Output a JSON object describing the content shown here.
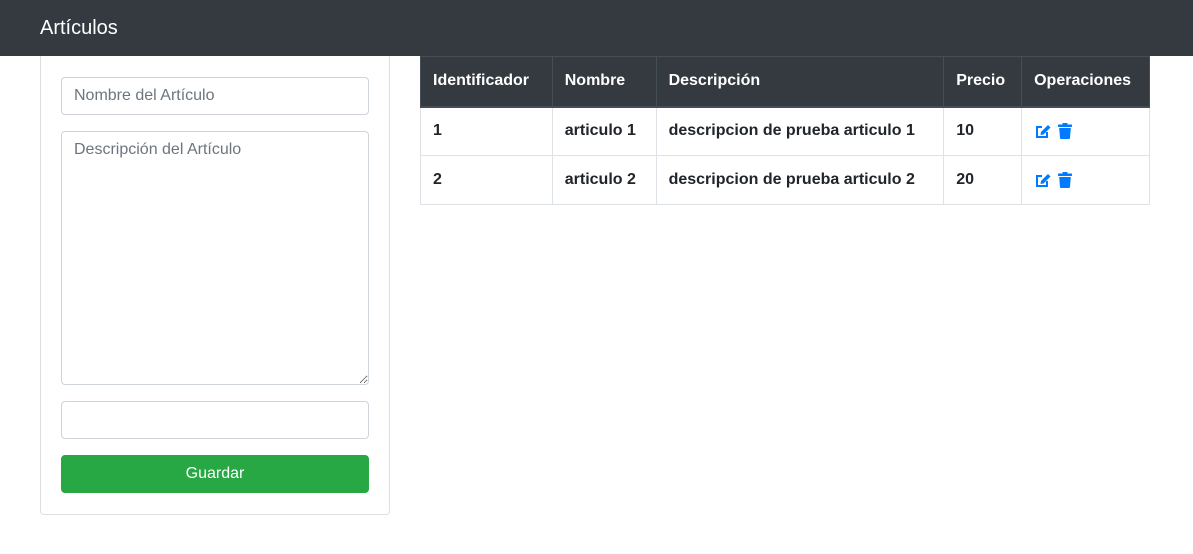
{
  "navbar": {
    "brand": "Artículos"
  },
  "form": {
    "name_placeholder": "Nombre del Artículo",
    "name_value": "",
    "description_placeholder": "Descripción del Artículo",
    "description_value": "",
    "price_placeholder": "",
    "price_value": "",
    "save_label": "Guardar"
  },
  "table": {
    "headers": {
      "id": "Identificador",
      "name": "Nombre",
      "description": "Descripción",
      "price": "Precio",
      "operations": "Operaciones"
    },
    "rows": [
      {
        "id": "1",
        "name": "articulo 1",
        "description": "descripcion de prueba articulo 1",
        "price": "10",
        "icons": [
          "edit-icon",
          "trash-icon"
        ]
      },
      {
        "id": "2",
        "name": "articulo 2",
        "description": "descripcion de prueba articulo 2",
        "price": "20",
        "icons": [
          "edit-icon",
          "trash-icon"
        ]
      }
    ]
  },
  "colors": {
    "navbar_bg": "#343a40",
    "table_header_bg": "#343a40",
    "save_button_bg": "#28a745",
    "icon_color": "#007bff"
  }
}
